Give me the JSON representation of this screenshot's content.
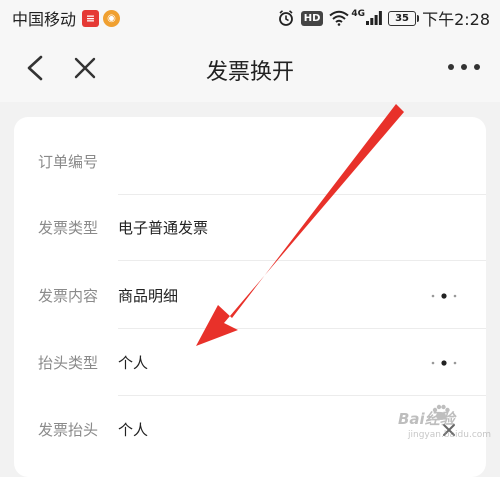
{
  "status_bar": {
    "carrier": "中国移动",
    "time": "下午2:28",
    "battery": "35",
    "hd_badge": "HD",
    "network": "4G"
  },
  "nav": {
    "title": "发票换开"
  },
  "form": {
    "rows": [
      {
        "label": "订单编号",
        "value": ""
      },
      {
        "label": "发票类型",
        "value": "电子普通发票"
      },
      {
        "label": "发票内容",
        "value": "商品明细"
      },
      {
        "label": "抬头类型",
        "value": "个人"
      },
      {
        "label": "发票抬头",
        "value": "个人"
      }
    ]
  },
  "watermark": {
    "brand": "Bai经验",
    "sub": "jingyan.baidu.com"
  },
  "colors": {
    "arrow": "#e8312a",
    "background": "#f2f2f2",
    "card": "#ffffff",
    "label_text": "#8a8a8a"
  }
}
